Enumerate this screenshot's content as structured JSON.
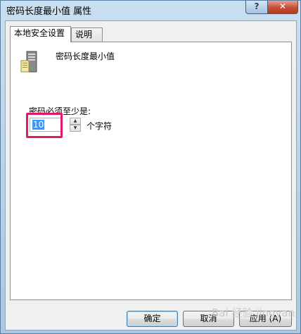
{
  "window": {
    "title": "密码长度最小值 属性",
    "help_label": "?",
    "close_label": "✕"
  },
  "tabs": [
    {
      "label": "本地安全设置",
      "active": true
    },
    {
      "label": "说明",
      "active": false
    }
  ],
  "policy": {
    "icon": "server-icon",
    "name": "密码长度最小值",
    "min_label": "密码必须至少是:",
    "value": "10",
    "unit": "个字符"
  },
  "buttons": {
    "ok": "确定",
    "cancel": "取消",
    "apply": "应用 (A)"
  },
  "watermark": "Bai 经验 jingyan",
  "colors": {
    "highlight": "#e0196a",
    "selection": "#3399ff"
  }
}
